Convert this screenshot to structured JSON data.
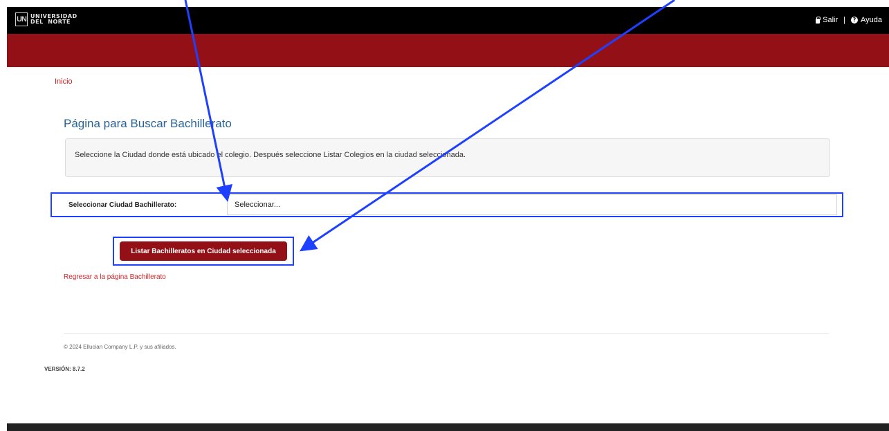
{
  "header": {
    "logo": {
      "mark": "UN",
      "line1": "UNIVERSIDAD",
      "line2": "DEL  NORTE"
    },
    "links": {
      "logout_label": "Salir",
      "separator": "|",
      "help_label": "Ayuda"
    },
    "icons": {
      "logout": "lock-icon",
      "help": "question-circle-icon"
    }
  },
  "breadcrumb": {
    "home_label": "Inicio"
  },
  "page": {
    "title": "Página para Buscar Bachillerato",
    "info_text": "Seleccione la Ciudad donde está ubicado el colegio. Después seleccione Listar Colegios en la ciudad seleccionada."
  },
  "form": {
    "ciudad_label": "Seleccionar Ciudad Bachillerato:",
    "ciudad_selected": "Seleccionar...",
    "submit_label": "Listar Bachilleratos en Ciudad seleccionada"
  },
  "links": {
    "back_label": "Regresar a la página Bachillerato"
  },
  "footer": {
    "copyright": "© 2024 Ellucian Company L.P. y sus afiliados.",
    "version": "VERSIÓN: 8.7.2"
  },
  "colors": {
    "brand_red": "#941017",
    "link_red": "#d31f26",
    "title_blue": "#2a6496",
    "annotation_blue": "#1e40ff"
  }
}
